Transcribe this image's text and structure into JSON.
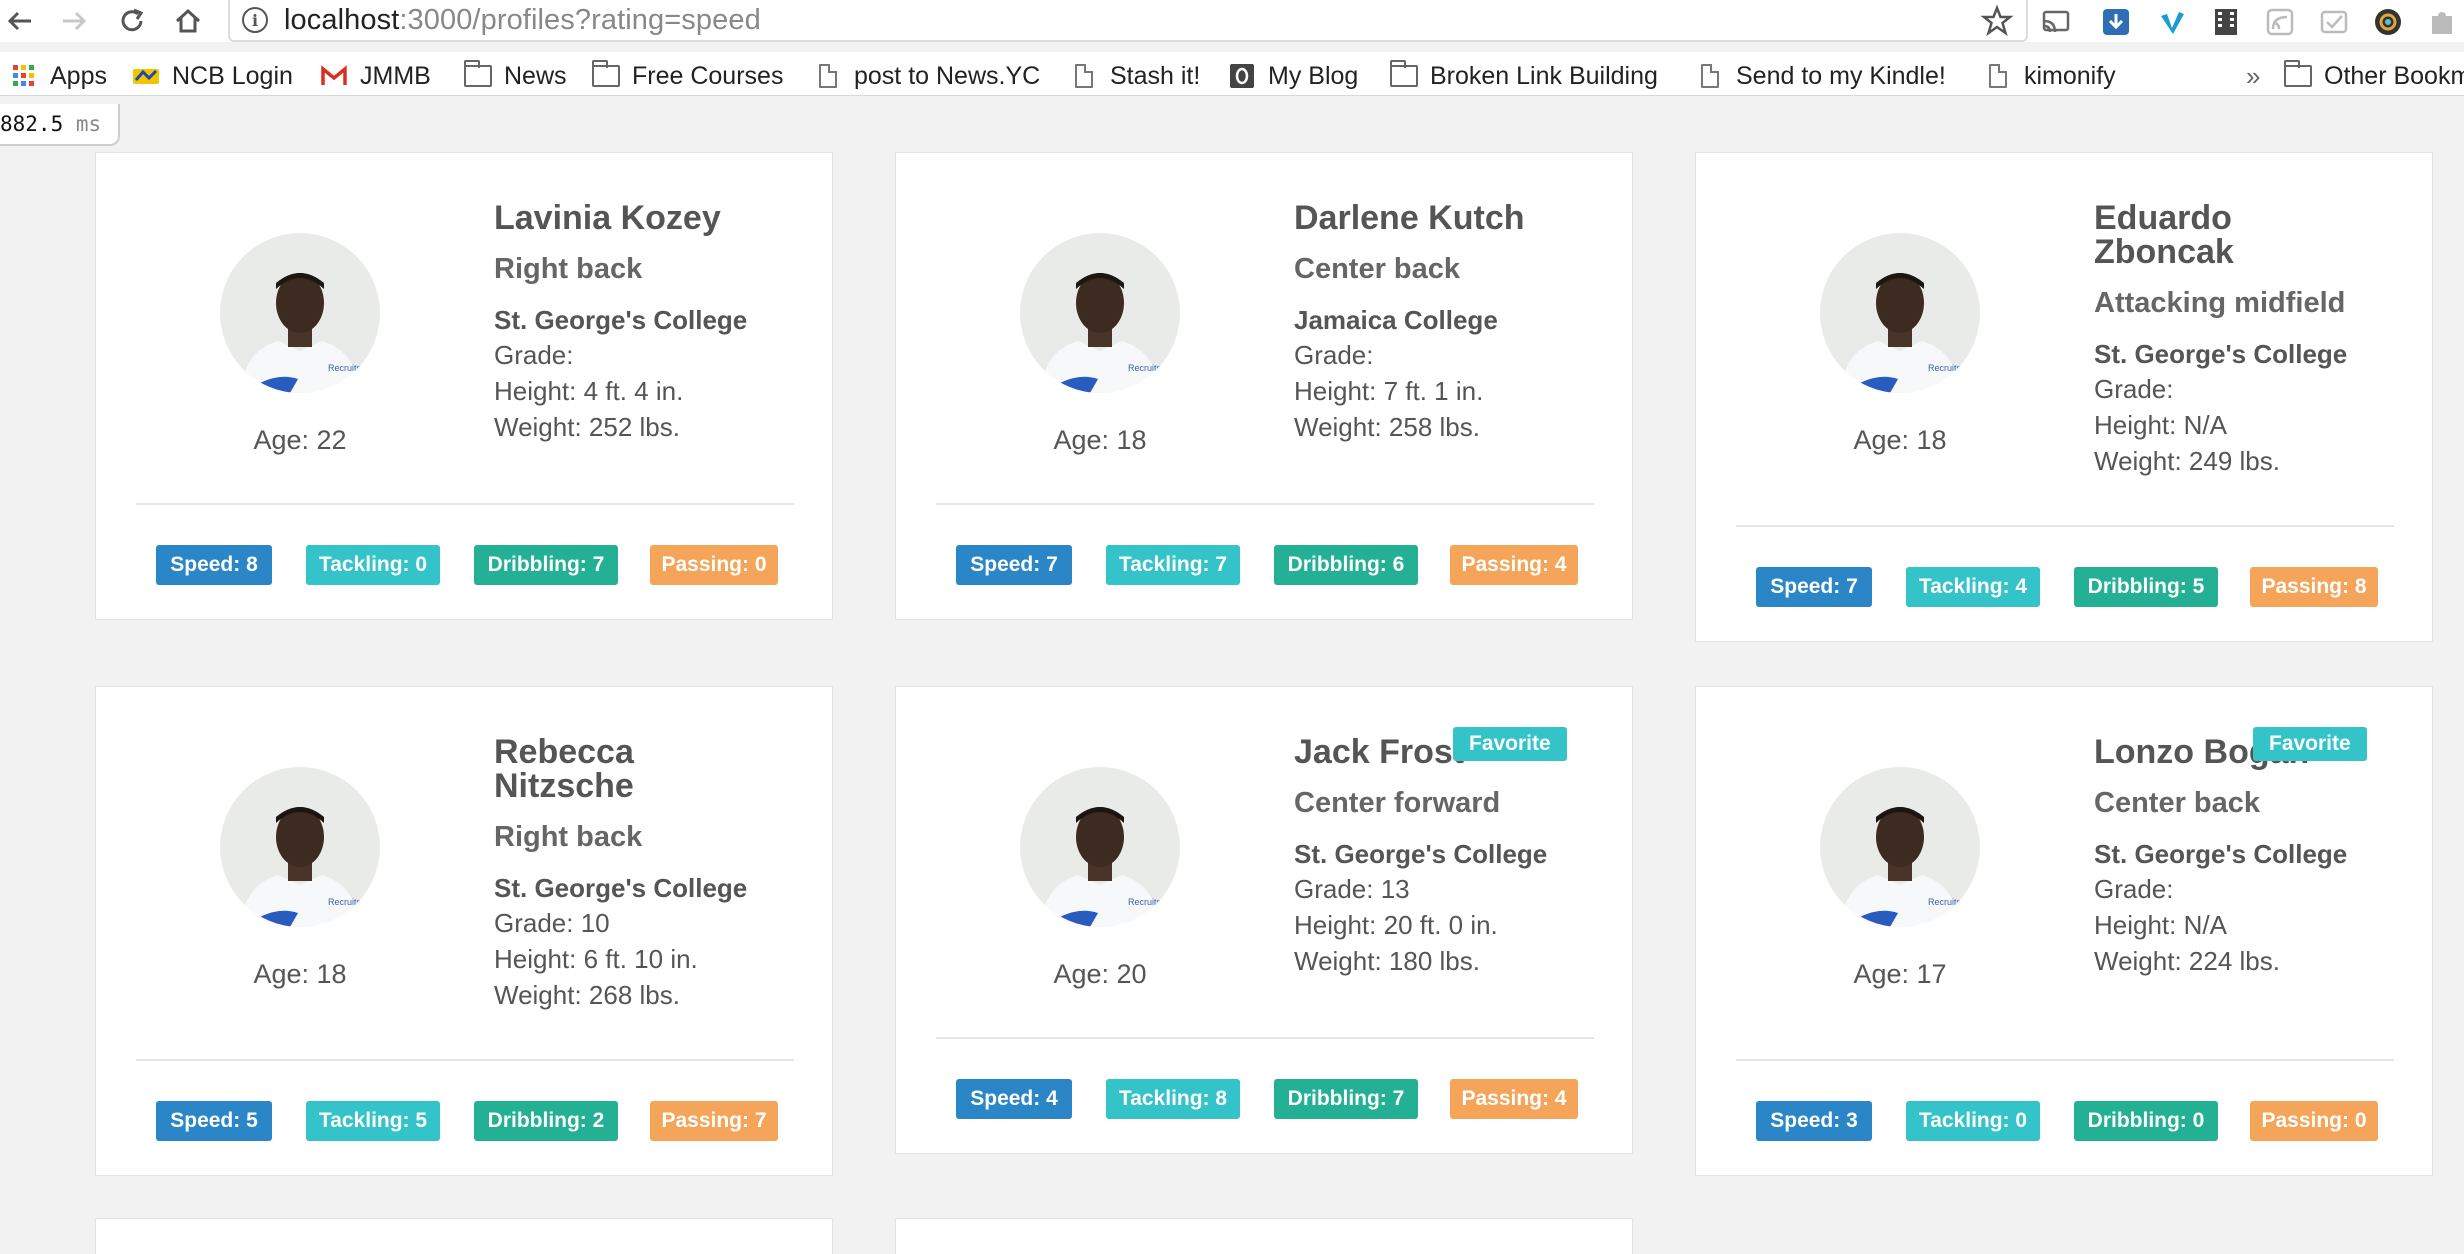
{
  "browser": {
    "url_host": "localhost",
    "url_path": ":3000/profiles?rating=speed",
    "bookmarks": [
      {
        "label": "Apps",
        "icon": "apps-grid-icon"
      },
      {
        "label": "NCB Login",
        "icon": "ncb-icon"
      },
      {
        "label": "JMMB",
        "icon": "gmail-icon"
      },
      {
        "label": "News",
        "icon": "folder-icon"
      },
      {
        "label": "Free Courses",
        "icon": "folder-icon"
      },
      {
        "label": "post to News.YC",
        "icon": "page-icon"
      },
      {
        "label": "Stash it!",
        "icon": "page-icon"
      },
      {
        "label": "My Blog",
        "icon": "blog-icon"
      },
      {
        "label": "Broken Link Building",
        "icon": "folder-icon"
      },
      {
        "label": "Send to my Kindle!",
        "icon": "page-icon"
      },
      {
        "label": "kimonify",
        "icon": "page-icon"
      }
    ],
    "overflow_label": "»",
    "other_bookmarks_label": "Other Bookm"
  },
  "timer": {
    "value": "882.5",
    "unit": "ms"
  },
  "stat_labels": {
    "speed": "Speed:",
    "tackling": "Tackling:",
    "dribbling": "Dribbling:",
    "passing": "Passing:"
  },
  "profiles": [
    {
      "name": "Lavinia Kozey",
      "position": "Right back",
      "school": "St. George's College",
      "grade": "Grade:",
      "height": "Height: 4 ft. 4 in.",
      "weight": "Weight: 252 lbs.",
      "age": "Age: 22",
      "speed": "Speed: 8",
      "tackling": "Tackling: 0",
      "dribbling": "Dribbling: 7",
      "passing": "Passing: 0",
      "favorite": ""
    },
    {
      "name": "Darlene Kutch",
      "position": "Center back",
      "school": "Jamaica College",
      "grade": "Grade:",
      "height": "Height: 7 ft. 1 in.",
      "weight": "Weight: 258 lbs.",
      "age": "Age: 18",
      "speed": "Speed: 7",
      "tackling": "Tackling: 7",
      "dribbling": "Dribbling: 6",
      "passing": "Passing: 4",
      "favorite": ""
    },
    {
      "name": "Eduardo Zboncak",
      "position": "Attacking midfield",
      "school": "St. George's College",
      "grade": "Grade:",
      "height": "Height: N/A",
      "weight": "Weight: 249 lbs.",
      "age": "Age: 18",
      "speed": "Speed: 7",
      "tackling": "Tackling: 4",
      "dribbling": "Dribbling: 5",
      "passing": "Passing: 8",
      "favorite": ""
    },
    {
      "name": "Rebecca Nitzsche",
      "position": "Right back",
      "school": "St. George's College",
      "grade": "Grade: 10",
      "height": "Height: 6 ft. 10 in.",
      "weight": "Weight: 268 lbs.",
      "age": "Age: 18",
      "speed": "Speed: 5",
      "tackling": "Tackling: 5",
      "dribbling": "Dribbling: 2",
      "passing": "Passing: 7",
      "favorite": ""
    },
    {
      "name": "Jack Frost",
      "position": "Center forward",
      "school": "St. George's College",
      "grade": "Grade: 13",
      "height": "Height: 20 ft. 0 in.",
      "weight": "Weight: 180 lbs.",
      "age": "Age: 20",
      "speed": "Speed: 4",
      "tackling": "Tackling: 8",
      "dribbling": "Dribbling: 7",
      "passing": "Passing: 4",
      "favorite": "Favorite"
    },
    {
      "name": "Lonzo Bogan",
      "position": "Center back",
      "school": "St. George's College",
      "grade": "Grade:",
      "height": "Height: N/A",
      "weight": "Weight: 224 lbs.",
      "age": "Age: 17",
      "speed": "Speed: 3",
      "tackling": "Tackling: 0",
      "dribbling": "Dribbling: 0",
      "passing": "Passing: 0",
      "favorite": "Favorite"
    }
  ]
}
